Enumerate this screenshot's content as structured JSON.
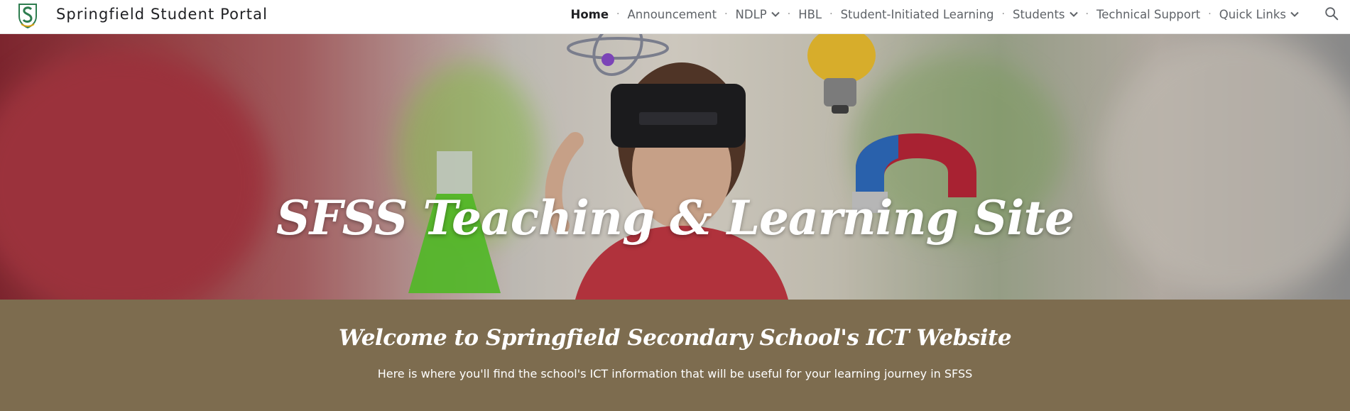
{
  "header": {
    "site_title": "Springfield Student Portal",
    "logo_icon": "school-crest-logo",
    "search_icon": "search-icon"
  },
  "nav": {
    "items": [
      {
        "label": "Home",
        "active": true,
        "dropdown": false
      },
      {
        "label": "Announcement",
        "active": false,
        "dropdown": false
      },
      {
        "label": "NDLP",
        "active": false,
        "dropdown": true
      },
      {
        "label": "HBL",
        "active": false,
        "dropdown": false
      },
      {
        "label": "Student-Initiated Learning",
        "active": false,
        "dropdown": false
      },
      {
        "label": "Students",
        "active": false,
        "dropdown": true
      },
      {
        "label": "Technical Support",
        "active": false,
        "dropdown": false
      },
      {
        "label": "Quick Links",
        "active": false,
        "dropdown": true
      }
    ],
    "separator": "·"
  },
  "hero": {
    "title": "SFSS Teaching & Learning Site"
  },
  "welcome": {
    "title": "Welcome to Springfield Secondary School's ICT Website",
    "text": "Here is where you'll find the school's ICT information that will be useful for your learning journey in SFSS"
  },
  "colors": {
    "header_bg": "#ffffff",
    "welcome_bg": "#7d6c4f",
    "nav_text": "#5f6368",
    "nav_active": "#202124"
  }
}
